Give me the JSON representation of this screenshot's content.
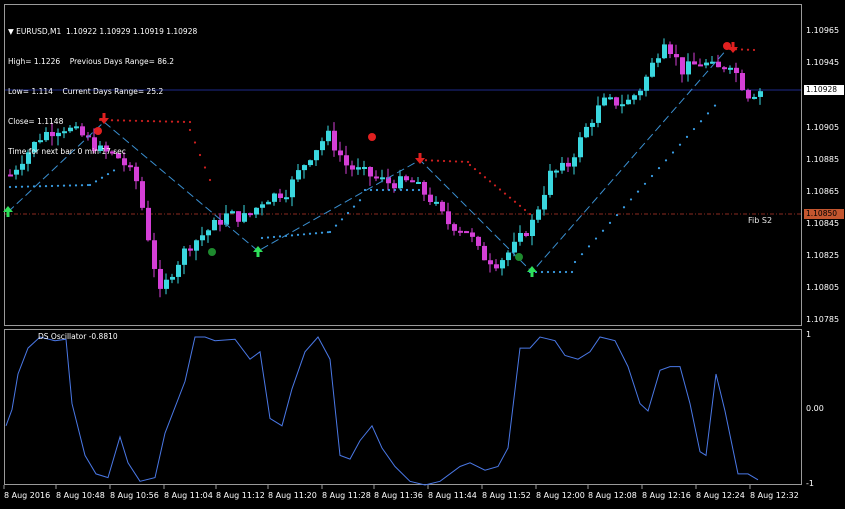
{
  "header": {
    "symbol": "EURUSD,M1",
    "ohlc": "1.10922 1.10929 1.10919 1.10928",
    "high_label": "High= 1.1226",
    "prev_days_range": "Previous Days Range= 86.2",
    "low_label": "Low= 1.114",
    "current_days_range": "Current Days Range= 25.2",
    "close_label": "Close= 1.1148",
    "time_next_bar": "Time for next bar: 0 min 17 sec"
  },
  "price_axis": {
    "ticks": [
      "1.10965",
      "1.10945",
      "1.10925",
      "1.10905",
      "1.10885",
      "1.10865",
      "1.10845",
      "1.10825",
      "1.10805",
      "1.10785"
    ],
    "current_price": "1.10928",
    "fib_price": "1.10850"
  },
  "fib_level": {
    "label": "Fib S2",
    "value": 1.1085
  },
  "oscillator": {
    "label": "DS Oscillator -0.8810",
    "ticks": [
      "1",
      "0.00",
      "-1"
    ]
  },
  "time_axis": [
    "8 Aug 2016",
    "8 Aug 10:48",
    "8 Aug 10:56",
    "8 Aug 11:04",
    "8 Aug 11:12",
    "8 Aug 11:20",
    "8 Aug 11:28",
    "8 Aug 11:36",
    "8 Aug 11:44",
    "8 Aug 11:52",
    "8 Aug 12:00",
    "8 Aug 12:08",
    "8 Aug 12:16",
    "8 Aug 12:24",
    "8 Aug 12:32"
  ],
  "colors": {
    "bull": "#3ad7df",
    "bear": "#d43fd6",
    "support_dots": "#3aa0e8",
    "resistance_dots": "#d02020",
    "zigzag": "#3a8fd0",
    "oscillator_line": "#4a78e6",
    "fib_line": "#8a2a20",
    "current_line": "#1e2a8a",
    "up_arrow": "#2ee05a",
    "down_arrow": "#e02020"
  },
  "chart_data": {
    "type": "candlestick",
    "series": [
      {
        "name": "EURUSD,M1",
        "close_levels": [
          1.10875,
          1.1088,
          1.1089,
          1.10905,
          1.109,
          1.10885,
          1.1086,
          1.1081,
          1.1083,
          1.1084,
          1.1085,
          1.1087,
          1.1086,
          1.1087,
          1.1089,
          1.109,
          1.1088,
          1.1087,
          1.1087,
          1.1086,
          1.1084,
          1.1083,
          1.1082,
          1.10825,
          1.1085,
          1.1088,
          1.1091,
          1.10925,
          1.10915,
          1.1094,
          1.10945,
          1.1094,
          1.1093
        ]
      },
      {
        "name": "DS Oscillator",
        "values": [
          0.5,
          -0.1,
          0.8,
          1.0,
          -0.5,
          -0.9,
          -0.3,
          -0.95,
          1.0,
          0.9,
          0.95,
          -0.8,
          0.6,
          0.0,
          1.0,
          -0.7,
          0.4,
          -0.85,
          -0.95,
          -0.8,
          -0.7,
          -0.75,
          0.85,
          1.0,
          0.8,
          1.0,
          0.3,
          -0.1,
          0.6,
          -0.5,
          0.5,
          -0.8,
          -0.9
        ]
      }
    ]
  }
}
